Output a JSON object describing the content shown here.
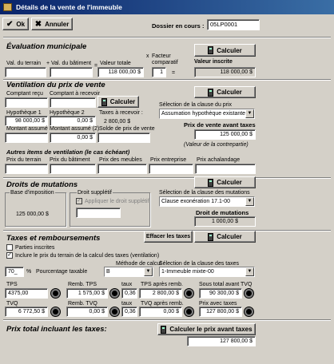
{
  "window": {
    "title": "Détails de la vente de l'immeuble"
  },
  "toolbar": {
    "ok": "Ok",
    "cancel": "Annuler"
  },
  "dossier": {
    "label": "Dossier en cours :",
    "value": "05LP0001"
  },
  "eval": {
    "title": "Évaluation municipale",
    "calc": "Calculer",
    "terrain_label": "Val. du terrain",
    "plus": "+",
    "batiment_label": "Val. du bâtiment",
    "eq": "=",
    "total_label": "Valeur totale",
    "total": "118 000,00 $",
    "x": "x",
    "facteur_label": "Facteur comparatif",
    "facteur": "1",
    "eq2": "=",
    "inscrite_label": "Valeur inscrite",
    "inscrite": "118 000,00 $"
  },
  "vent": {
    "title": "Ventilation du prix de vente",
    "calc": "Calculer",
    "comptant_label": "Comptant reçu",
    "comptant_rec_label": "Comptant à recevoir",
    "calc2": "Calculer",
    "hyp1_label": "Hypothèque 1",
    "hyp1": "98 000,00 $",
    "hyp2_label": "Hypothèque 2",
    "hyp2": "0,00 $",
    "taxes_label": "Taxes à recevoir :",
    "taxes": "2 800,00 $",
    "assume_label": "Montant assumé",
    "assume2_label": "Montant assumé (2)",
    "assume2": "0,00 $",
    "solde_label": "Solde de prix de vente",
    "clause_label": "Sélection de la clause du prix",
    "clause": "Assumation hypothèque existante - X",
    "pv_label": "Prix de vente avant taxes",
    "pv": "125 000,00 $",
    "contrepartie": "(Valeur de la contrepartie)"
  },
  "autres": {
    "title": "Autres items de ventilation (le cas échéant)",
    "terrain": "Prix du terrain",
    "batiment": "Prix du bâtiment",
    "meubles": "Prix des meubles",
    "entreprise": "Prix entreprise",
    "achalandage": "Prix achalandage"
  },
  "droits": {
    "title": "Droits de mutations",
    "calc": "Calculer",
    "base_label": "Base d'imposition",
    "base": "125 000,00 $",
    "supp_label": "Droit supplétif",
    "supp_check": "Appliquer le droit supplétif",
    "clause_label": "Sélection de la clause des mutations",
    "clause": "Clause exonération 17.1-00",
    "droit_label": "Droit de mutations",
    "droit": "1 000,00 $"
  },
  "taxes": {
    "title": "Taxes et remboursements",
    "effacer": "Effacer les taxes",
    "calc": "Calculer",
    "parties": "Parties inscrites",
    "inclure": "Inclure le prix du terrain de la calcul des taxes (ventilation)",
    "pct": "70_",
    "pct_sign": "%",
    "pct_label": "Pourcentage taxable",
    "methode_label": "Méthode de calcul",
    "methode": "B",
    "clause_label": "Sélection de la clause des taxes",
    "clause": "1-Immeuble mixte-00",
    "tps_label": "TPS",
    "tps": "4375,00",
    "remb_tps_label": "Remb. TPS",
    "remb_tps": "1 575,00 $",
    "taux_label": "taux",
    "taux1": "0,36",
    "tps_apres_label": "TPS après remb.",
    "tps_apres": "2 800,00 $",
    "sous_total_label": "Sous total avant TVQ",
    "sous_total": "90 300,00 $",
    "tvq_label": "TVQ",
    "tvq": "6 772,50 $",
    "remb_tvq_label": "Remb. TVQ",
    "remb_tvq": "0,00 $",
    "taux2_label": "taux",
    "taux2": "0,36",
    "tvq_apres_label": "TVQ après remb.",
    "tvq_apres": "0,00 $",
    "prix_taxes_label": "Prix avec taxes",
    "prix_taxes": "127 800,00 $"
  },
  "total": {
    "title": "Prix total incluant les taxes:",
    "calc": "Calculer le prix avant taxes",
    "value": "127 800,00 $"
  }
}
